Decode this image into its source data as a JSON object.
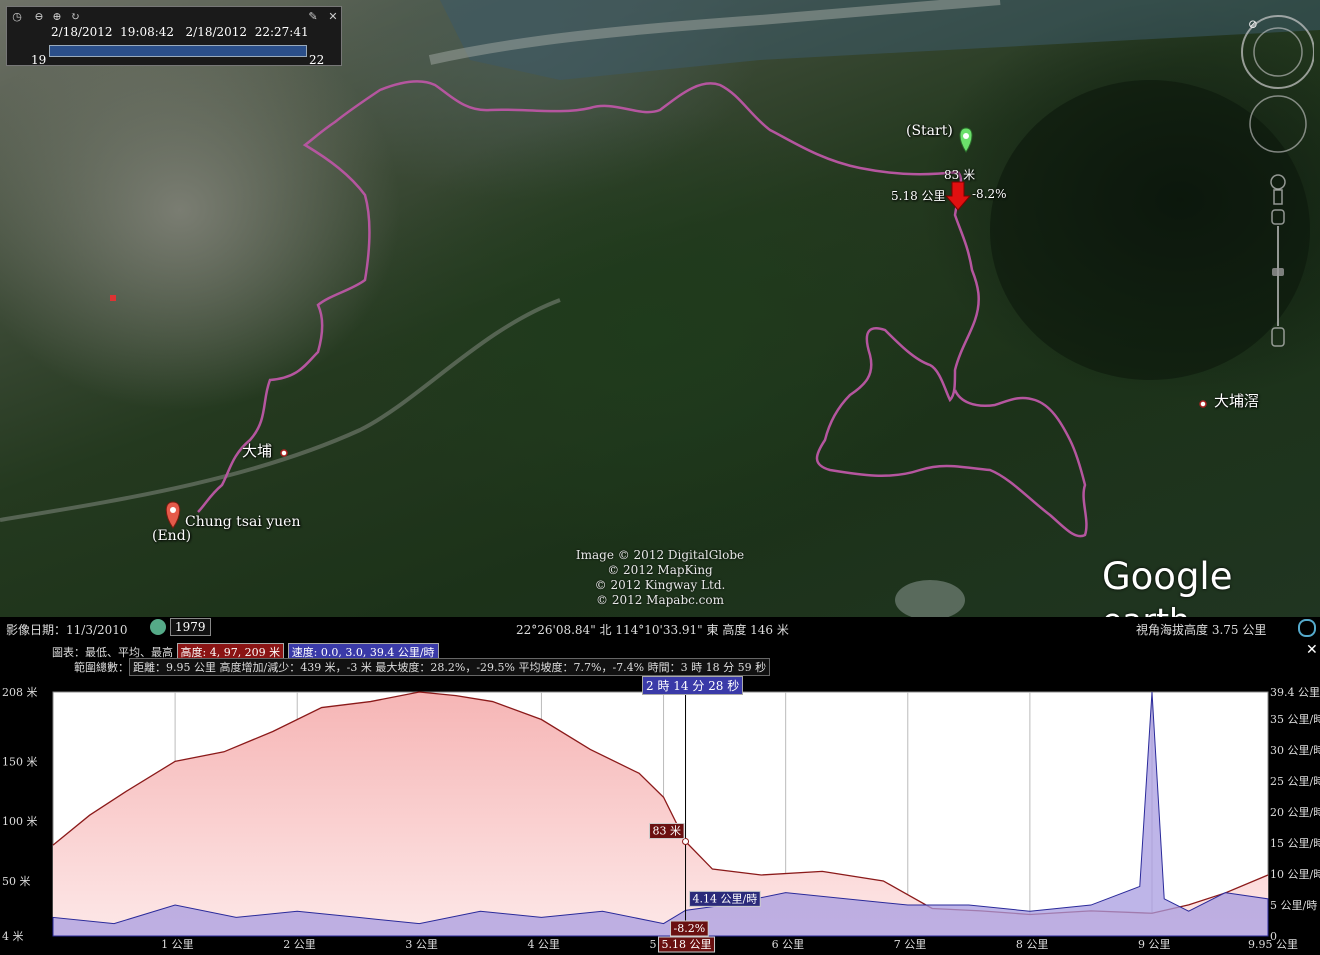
{
  "timeslider": {
    "start_date": "2/18/2012",
    "start_time": "19:08:42",
    "end_date": "2/18/2012",
    "end_time": "22:27:41",
    "start_hour": "19",
    "end_hour": "22",
    "icons": [
      "clock-icon",
      "zoom-out-icon",
      "zoom-in-icon",
      "zoom-reset-icon",
      "wrench-icon",
      "close-icon"
    ]
  },
  "map": {
    "labels": {
      "start": "(Start)",
      "end": "(End)",
      "end_place": "Chung tsai yuen",
      "town_taipo": "大埔",
      "town_taipo_kau": "大埔滘",
      "marker_elev": "83 米",
      "marker_dist": "5.18 公里",
      "marker_grade": "-8.2%"
    },
    "copyright": [
      "Image © 2012 DigitalGlobe",
      "© 2012 MapKing",
      "© 2012 Kingway Ltd.",
      "© 2012 Mapabc.com"
    ],
    "logo_main": "Google",
    "logo_sub": "earth",
    "track_color": "#b5569f"
  },
  "status": {
    "imagery_date_label": "影像日期：11/3/2010",
    "year": "1979",
    "coords": "22°26'08.84\" 北 114°10'33.91\" 東 高度   146 米",
    "eye_alt": "視角海拔高度     3.75 公里"
  },
  "profile": {
    "header_label": "圖表：最低、平均、最高",
    "elev_tag": "高度: 4, 97, 209 米",
    "speed_tag": "速度: 0.0, 3.0, 39.4 公里/時",
    "range_label": "範圍總數：",
    "range_stats": "距離：9.95 公里 高度增加/減少：439 米，-3 米   最大坡度：28.2%，-29.5%   平均坡度：7.7%，-7.4%   時間：3 時 18 分 59 秒",
    "cursor_time": "2 時 14 分 28 秒",
    "cursor_elev": "83 米",
    "cursor_speed": "4.14 公里/時",
    "cursor_grade": "-8.2%",
    "cursor_dist": "5.18 公里",
    "y_left": [
      "208 米",
      "150 米",
      "100 米",
      "50 米",
      "4 米"
    ],
    "y_right": [
      "39.4 公里/時",
      "35 公里/時",
      "30 公里/時",
      "25 公里/時",
      "20 公里/時",
      "15 公里/時",
      "10 公里/時",
      "5 公里/時",
      "0"
    ],
    "x_labels": [
      "1 公里",
      "2 公里",
      "3 公里",
      "4 公里",
      "5 公里",
      "6 公里",
      "7 公里",
      "8 公里",
      "9 公里",
      "9.95 公里"
    ],
    "colors": {
      "elev_fill": "#f6c2c2",
      "elev_line": "#8b1a1a",
      "speed_fill": "#a89ce0",
      "speed_line": "#2a2a9a"
    }
  },
  "chart_data": {
    "type": "area",
    "title": "",
    "xlabel": "",
    "ylabel": "",
    "xlim": [
      0,
      9.95
    ],
    "ylim": [
      4,
      208
    ],
    "grid": true,
    "series": [
      {
        "name": "高度",
        "unit": "米",
        "x": [
          0,
          0.3,
          0.6,
          1.0,
          1.4,
          1.8,
          2.2,
          2.6,
          3.0,
          3.3,
          3.6,
          4.0,
          4.4,
          4.8,
          5.0,
          5.18,
          5.4,
          5.8,
          6.3,
          6.8,
          7.2,
          7.6,
          8.0,
          8.5,
          9.0,
          9.3,
          9.6,
          9.95
        ],
        "values": [
          80,
          105,
          125,
          150,
          158,
          175,
          195,
          200,
          208,
          205,
          200,
          185,
          160,
          140,
          120,
          83,
          60,
          55,
          58,
          50,
          27,
          25,
          22,
          25,
          23,
          30,
          40,
          55
        ]
      },
      {
        "name": "速度",
        "unit": "公里/時",
        "x": [
          0,
          0.5,
          1.0,
          1.5,
          2.0,
          2.5,
          3.0,
          3.5,
          4.0,
          4.5,
          5.0,
          5.18,
          5.5,
          6.0,
          6.5,
          7.0,
          7.5,
          8.0,
          8.5,
          8.9,
          9.0,
          9.1,
          9.3,
          9.6,
          9.95
        ],
        "values": [
          3,
          2,
          5,
          3,
          4,
          3,
          2,
          4,
          3,
          4,
          2,
          4.14,
          5,
          7,
          6,
          5,
          5,
          4,
          5,
          8,
          39.4,
          6,
          4,
          7,
          6
        ]
      }
    ]
  }
}
